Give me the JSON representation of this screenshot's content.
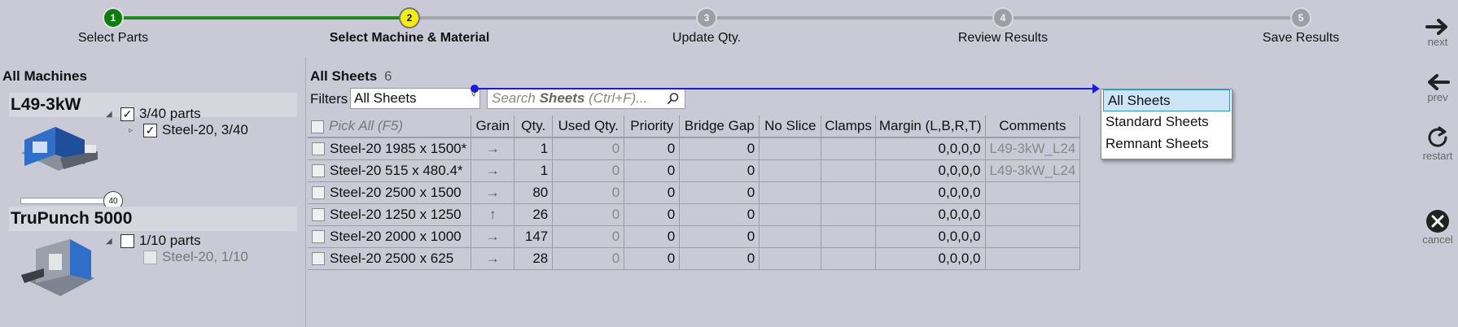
{
  "wizard": {
    "steps": [
      {
        "number": "1",
        "label": "Select Parts",
        "state": "done"
      },
      {
        "number": "2",
        "label": "Select Machine & Material",
        "state": "current"
      },
      {
        "number": "3",
        "label": "Update Qty.",
        "state": "pending"
      },
      {
        "number": "4",
        "label": "Review Results",
        "state": "pending"
      },
      {
        "number": "5",
        "label": "Save Results",
        "state": "pending"
      }
    ]
  },
  "nav": {
    "next": "next",
    "prev": "prev",
    "restart": "restart",
    "cancel": "cancel"
  },
  "machines": {
    "title": "All Machines",
    "list": [
      {
        "name": "L49-3kW",
        "parts_label": "3/40 parts",
        "checked": true,
        "material": "Steel-20, 3/40",
        "material_checked": true,
        "slider_value": "40"
      },
      {
        "name": "TruPunch 5000",
        "parts_label": "1/10 parts",
        "checked": false,
        "material": "Steel-20, 1/10",
        "material_checked": false
      }
    ]
  },
  "sheets": {
    "title": "All Sheets",
    "count": "6",
    "filters_label": "Filters",
    "filter_value": "All Sheets",
    "search_prefix": "Search ",
    "search_bold": "Sheets",
    "search_suffix": " (Ctrl+F)...",
    "columns": [
      "Pick All (F5)",
      "Grain",
      "Qty.",
      "Used Qty.",
      "Priority",
      "Bridge Gap",
      "No Slice",
      "Clamps",
      "Margin (L,B,R,T)",
      "Comments"
    ],
    "rows": [
      {
        "name": "Steel-20 1985 x 1500*",
        "grain": "→",
        "qty": "1",
        "used": "0",
        "priority": "0",
        "bridge": "0",
        "no_slice": "",
        "clamps": "",
        "margin": "0,0,0,0",
        "comments": "L49-3kW_L24"
      },
      {
        "name": "Steel-20 515 x 480.4*",
        "grain": "→",
        "qty": "1",
        "used": "0",
        "priority": "0",
        "bridge": "0",
        "no_slice": "",
        "clamps": "",
        "margin": "0,0,0,0",
        "comments": "L49-3kW_L24"
      },
      {
        "name": "Steel-20 2500 x 1500",
        "grain": "→",
        "qty": "80",
        "used": "0",
        "priority": "0",
        "bridge": "0",
        "no_slice": "",
        "clamps": "",
        "margin": "0,0,0,0",
        "comments": ""
      },
      {
        "name": "Steel-20 1250 x 1250",
        "grain": "↑",
        "qty": "26",
        "used": "0",
        "priority": "0",
        "bridge": "0",
        "no_slice": "",
        "clamps": "",
        "margin": "0,0,0,0",
        "comments": ""
      },
      {
        "name": "Steel-20 2000 x 1000",
        "grain": "→",
        "qty": "147",
        "used": "0",
        "priority": "0",
        "bridge": "0",
        "no_slice": "",
        "clamps": "",
        "margin": "0,0,0,0",
        "comments": ""
      },
      {
        "name": "Steel-20 2500 x 625",
        "grain": "→",
        "qty": "28",
        "used": "0",
        "priority": "0",
        "bridge": "0",
        "no_slice": "",
        "clamps": "",
        "margin": "0,0,0,0",
        "comments": ""
      }
    ]
  },
  "dropdown": {
    "options": [
      "All Sheets",
      "Standard Sheets",
      "Remnant Sheets"
    ],
    "selected": "All Sheets"
  },
  "colors": {
    "background": "#c9cad5",
    "step_done": "#0e7d10",
    "step_current": "#f6ee10",
    "annotation_line": "#1a1ae0",
    "dropdown_selected": "#cde6f7"
  }
}
